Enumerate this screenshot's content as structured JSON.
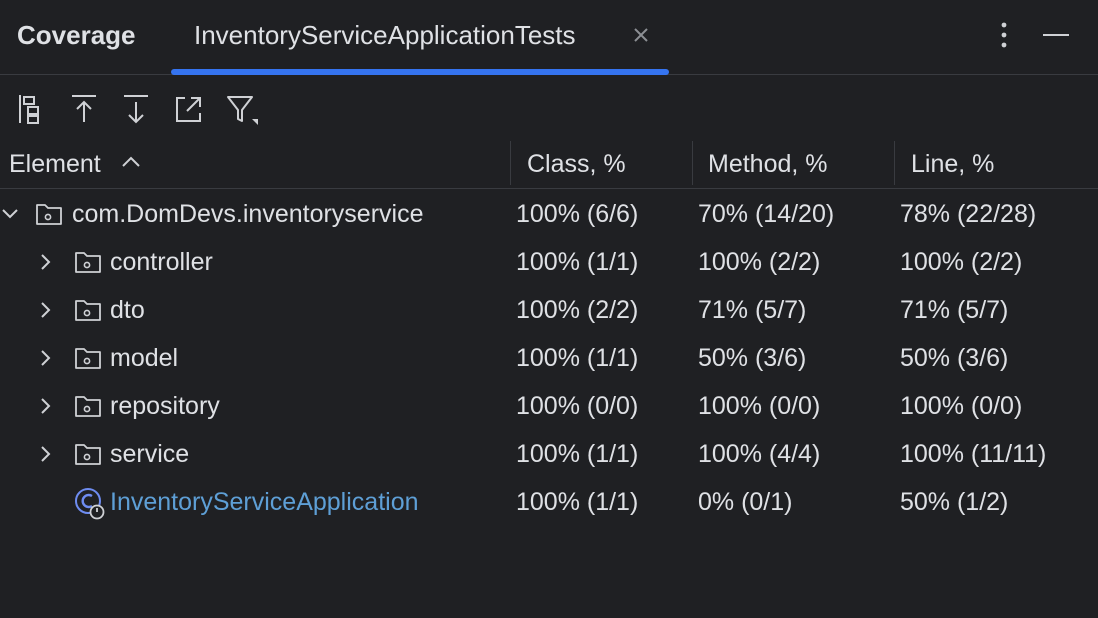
{
  "tool_window": {
    "title": "Coverage",
    "tab_label": "InventoryServiceApplicationTests",
    "accent_color": "#3574f0"
  },
  "toolbar": {
    "buttons": [
      {
        "icon": "flatten-packages-icon"
      },
      {
        "icon": "navigate-up-icon"
      },
      {
        "icon": "navigate-down-icon"
      },
      {
        "icon": "export-icon"
      },
      {
        "icon": "filter-icon"
      }
    ]
  },
  "table": {
    "columns": [
      "Element",
      "Class, %",
      "Method, %",
      "Line, %"
    ],
    "sort": {
      "column": "Element",
      "direction": "ascending"
    },
    "rows": [
      {
        "name": "com.DomDevs.inventoryservice",
        "kind": "package",
        "expanded": true,
        "level": 0,
        "class": "100% (6/6)",
        "method": "70% (14/20)",
        "line": "78% (22/28)"
      },
      {
        "name": "controller",
        "kind": "package",
        "expanded": false,
        "level": 1,
        "class": "100% (1/1)",
        "method": "100% (2/2)",
        "line": "100% (2/2)"
      },
      {
        "name": "dto",
        "kind": "package",
        "expanded": false,
        "level": 1,
        "class": "100% (2/2)",
        "method": "71% (5/7)",
        "line": "71% (5/7)"
      },
      {
        "name": "model",
        "kind": "package",
        "expanded": false,
        "level": 1,
        "class": "100% (1/1)",
        "method": "50% (3/6)",
        "line": "50% (3/6)"
      },
      {
        "name": "repository",
        "kind": "package",
        "expanded": false,
        "level": 1,
        "class": "100% (0/0)",
        "method": "100% (0/0)",
        "line": "100% (0/0)"
      },
      {
        "name": "service",
        "kind": "package",
        "expanded": false,
        "level": 1,
        "class": "100% (1/1)",
        "method": "100% (4/4)",
        "line": "100% (11/11)"
      },
      {
        "name": "InventoryServiceApplication",
        "kind": "class",
        "level": 1,
        "class": "100% (1/1)",
        "method": "0% (0/1)",
        "line": "50% (1/2)",
        "color": "#5e9fd6"
      }
    ]
  }
}
